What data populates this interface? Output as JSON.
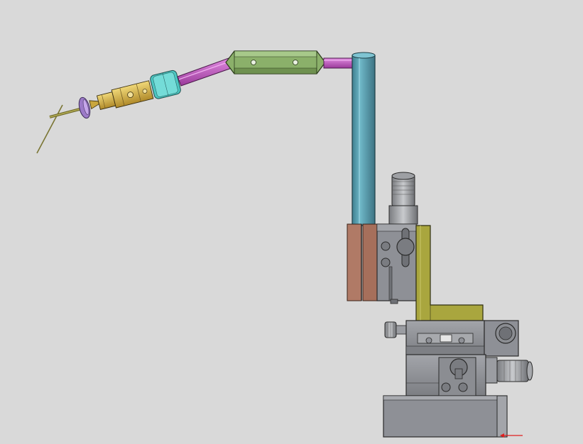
{
  "viewport": {
    "background": "#d9d9d9",
    "description_icon": "cad-3d-assembly"
  },
  "colors": {
    "outline": "#2a2a2a",
    "steel": "#8e9096",
    "steel_dark": "#6f7176",
    "steel_light": "#b4b6bb",
    "olive": "#a9a63e",
    "copper": "#b07a66",
    "teal_rod": "#5aa3b3",
    "green_clamp": "#8fb26a",
    "magenta_rod": "#c45ac4",
    "cyan_collar": "#4fc7c4",
    "gold_holder": "#d8b84a",
    "purple_ring": "#a07ac8",
    "needle": "#8f8a3c",
    "triad_red": "#e02020"
  }
}
